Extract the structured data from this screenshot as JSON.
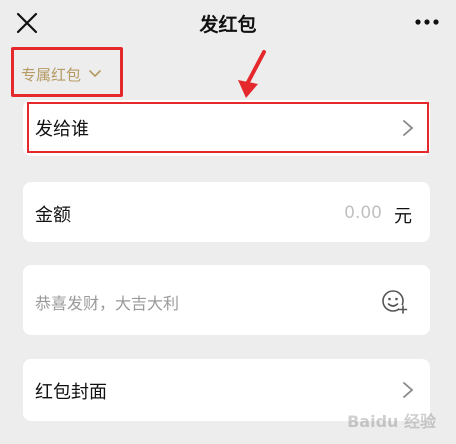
{
  "header": {
    "title": "发红包",
    "close_icon": "close-icon",
    "more_icon": "more-dots-icon"
  },
  "packet_type": {
    "label": "专属红包",
    "icon": "chevron-down-icon",
    "color": "#b59a63"
  },
  "recipient": {
    "label": "发给谁",
    "icon": "chevron-right-icon"
  },
  "amount": {
    "label": "金额",
    "value": "0.00",
    "unit": "元"
  },
  "greeting": {
    "placeholder": "恭喜发财，大吉大利",
    "icon": "emoji-add-icon"
  },
  "cover": {
    "label": "红包封面",
    "icon": "chevron-right-icon"
  },
  "annotation": {
    "color": "#e5282c"
  },
  "watermark": {
    "text": "Baidu 经验"
  }
}
